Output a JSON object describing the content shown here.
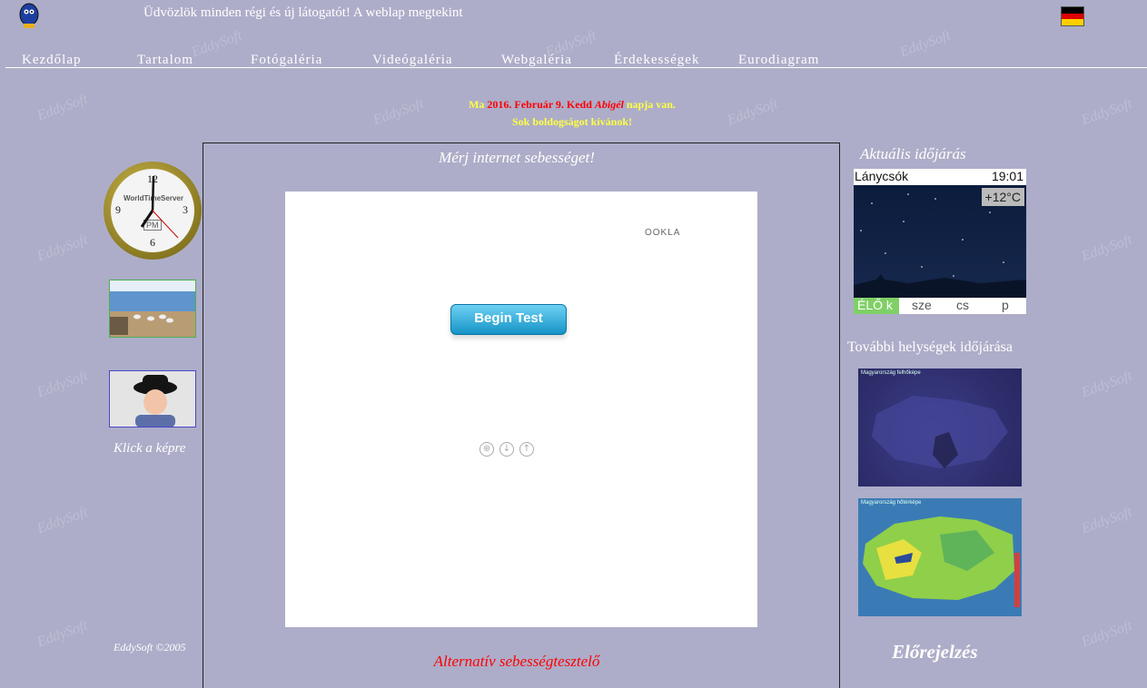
{
  "header": {
    "marquee_text": "Üdvözlök minden régi és új látogatót! A weblap megtekint",
    "watermark": "EddySoft"
  },
  "nav": [
    "Kezdőlap",
    "Tartalom",
    "Fotógaléria",
    "Videógaléria",
    "Webgaléria",
    "Érdekességek",
    "Eurodiagram"
  ],
  "greeting": {
    "ma": "Ma",
    "date": "2016. Február 9. Kedd",
    "name": "Abigél",
    "suffix": "napja van.",
    "wish": "Sok boldogságot kívánok!"
  },
  "left": {
    "clock_brand": "WorldTimeServer",
    "clock_ampm": "PM",
    "clock_numbers": [
      "12",
      "3",
      "6",
      "9"
    ],
    "click_text": "Klick a képre",
    "copyright": "EddySoft ©2005"
  },
  "center": {
    "title": "Mérj internet sebességet!",
    "ookla": "OOKLA",
    "begin_button": "Begin Test",
    "alt_link": "Alternatív sebességtesztelő"
  },
  "right": {
    "weather_title": "Aktuális időjárás",
    "location": "Lánycsók",
    "time": "19:01",
    "temp": "+12°C",
    "tabs": [
      "ÉLŐ k",
      "sze",
      "cs",
      "p"
    ],
    "more_title": "További helységek időjárása",
    "map1_label": "Magyarország felhőképe",
    "map2_label": "Magyarország hőtérképe",
    "forecast_title": "Előrejelzés"
  }
}
